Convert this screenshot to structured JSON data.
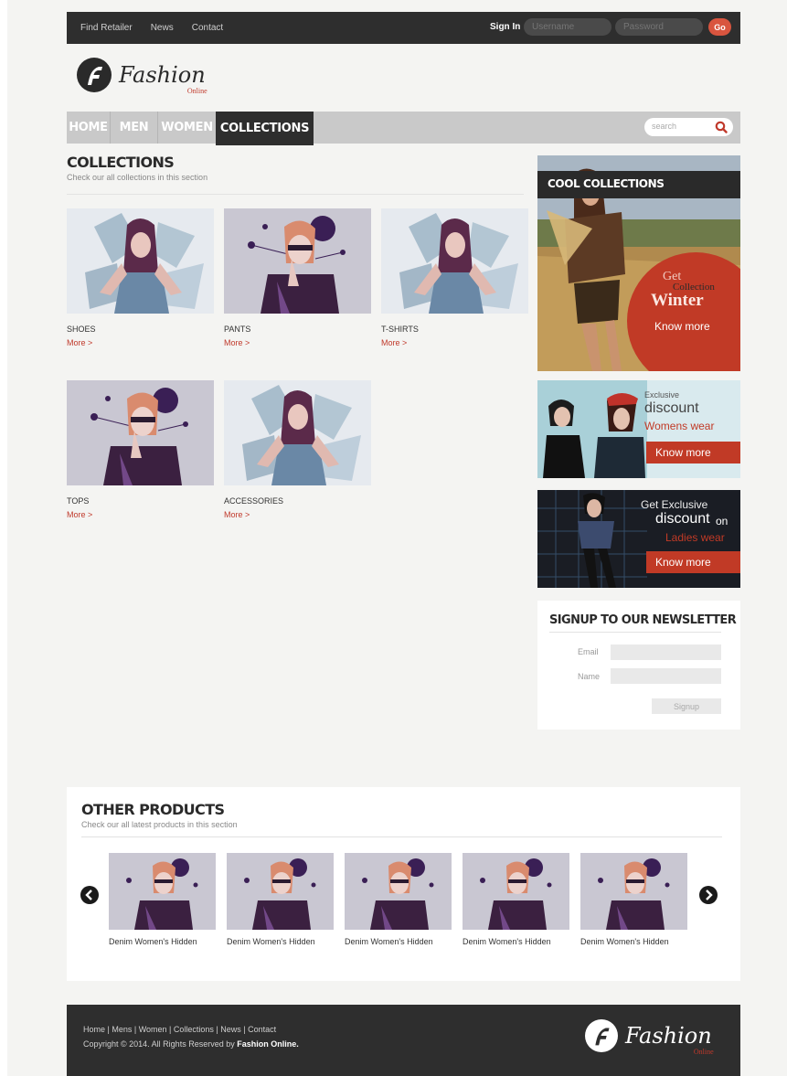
{
  "topbar": {
    "links": [
      "Find Retailer",
      "News",
      "Contact"
    ],
    "sign_in": "Sign In",
    "username_placeholder": "Username",
    "password_placeholder": "Password",
    "go": "Go"
  },
  "logo": {
    "word": "Fashion",
    "sub": "Online"
  },
  "nav": {
    "items": [
      "HOME",
      "MEN",
      "WOMEN",
      "COLLECTIONS"
    ],
    "search_placeholder": "search"
  },
  "collections": {
    "title": "COLLECTIONS",
    "subtitle": "Check our all collections in this section",
    "more_label": "More >",
    "items": [
      "SHOES",
      "PANTS",
      "T-SHIRTS",
      "TOPS",
      "ACCESSORIES"
    ]
  },
  "sidebar": {
    "cool": {
      "title": "COOL COLLECTIONS",
      "get": "Get",
      "collection": "Collection",
      "winter": "Winter",
      "cta": "Know more"
    },
    "promo1": {
      "exclusive": "Exclusive",
      "discount": "discount",
      "target": "Womens wear",
      "cta": "Know more"
    },
    "promo2": {
      "get_exclusive": "Get Exclusive",
      "discount": "discount",
      "on": "on",
      "target": "Ladies wear",
      "cta": "Know more"
    },
    "newsletter": {
      "title": "SIGNUP TO OUR NEWSLETTER",
      "email_label": "Email",
      "name_label": "Name",
      "signup": "Signup"
    }
  },
  "other": {
    "title": "OTHER PRODUCTS",
    "subtitle": "Check our all latest products in this section",
    "products": [
      "Denim Women's Hidden",
      "Denim Women's Hidden",
      "Denim Women's Hidden",
      "Denim Women's Hidden",
      "Denim Women's Hidden"
    ]
  },
  "footer": {
    "links": "Home | Mens | Women | Collections | News | Contact",
    "copyright": "Copyright © 2014. All Rights Reserved by",
    "brand": "Fashion Online."
  },
  "colors": {
    "accent": "#c13a26",
    "dark": "#2e2e2e",
    "nav": "#c9c9c9"
  }
}
